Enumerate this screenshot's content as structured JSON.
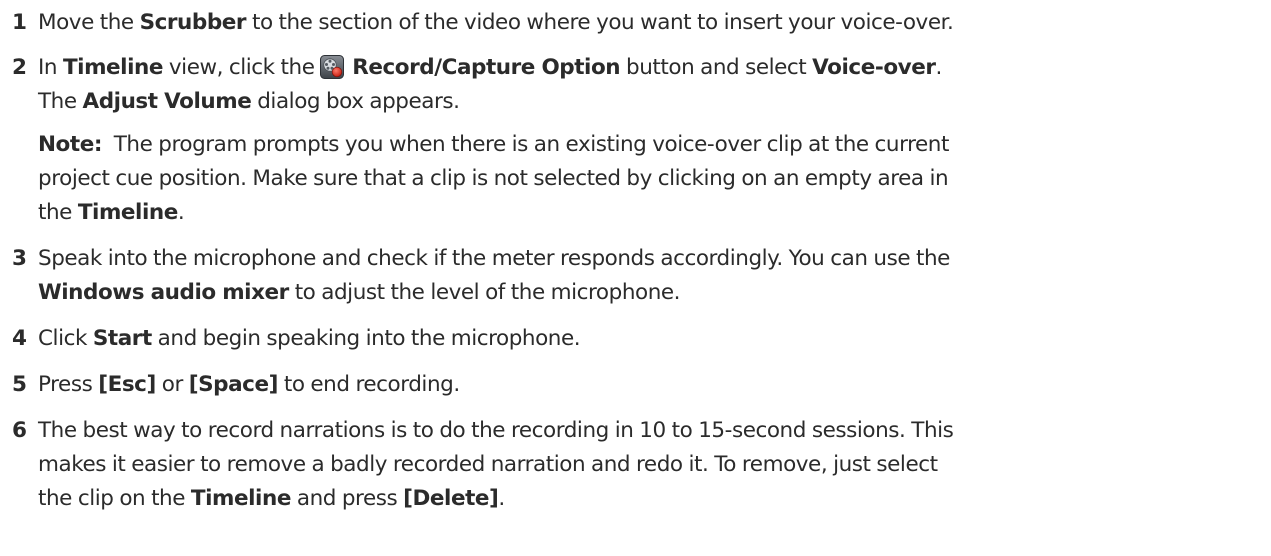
{
  "steps": [
    {
      "num": "1",
      "t1": "Move the ",
      "b1": "Scrubber",
      "t2": " to the section of the video where you want to insert your voice-over."
    },
    {
      "num": "2",
      "t1": "In ",
      "b1": "Timeline",
      "t2": " view, click the ",
      "icon": "record-capture-icon",
      "b2": "Record/Capture Option",
      "t3": " button and select ",
      "b3": "Voice-over",
      "t4": ".",
      "l2_t1": "The ",
      "l2_b1": "Adjust Volume",
      "l2_t2": " dialog box appears.",
      "note": {
        "label": "Note:",
        "line1": "  The program prompts you when there is an existing voice-over clip at the current",
        "line2": "project cue position. Make sure that a clip is not selected by clicking on an empty area in",
        "line3_t1": "the ",
        "line3_b1": "Timeline",
        "line3_t2": "."
      }
    },
    {
      "num": "3",
      "t1": "Speak into the microphone and check if the meter responds accordingly. You can use the",
      "l2_b1": "Windows audio mixer",
      "l2_t1": " to adjust the level of the microphone."
    },
    {
      "num": "4",
      "t1": "Click ",
      "b1": "Start",
      "t2": " and begin speaking into the microphone."
    },
    {
      "num": "5",
      "t1": "Press ",
      "b1": "[Esc]",
      "t2": " or ",
      "b2": "[Space]",
      "t3": " to end recording."
    },
    {
      "num": "6",
      "line1": "The best way to record narrations is to do the recording in 10 to 15-second sessions. This",
      "line2": "makes it easier to remove a badly recorded narration and redo it. To remove, just select",
      "l3_t1": "the clip on the ",
      "l3_b1": "Timeline",
      "l3_t2": " and press ",
      "l3_b2": "[Delete]",
      "l3_t3": "."
    }
  ]
}
